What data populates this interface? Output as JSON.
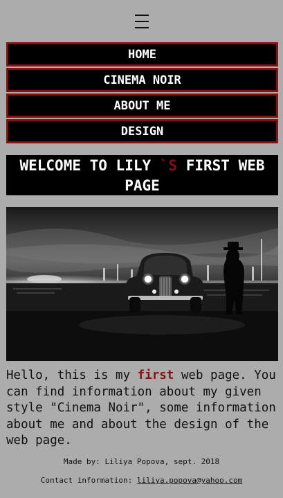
{
  "menu_icon": "hamburger-menu-icon",
  "nav": {
    "items": [
      {
        "label": "HOME"
      },
      {
        "label": "CINEMA NOIR"
      },
      {
        "label": "ABOUT ME"
      },
      {
        "label": "DESIGN"
      }
    ]
  },
  "hero": {
    "title_before": "WELCOME TO LILY ",
    "title_accent": "`S",
    "title_after": " FIRST WEB PAGE"
  },
  "photo": {
    "icon": "noir-car-city-night-photo"
  },
  "intro": {
    "before": "Hello, this is my ",
    "highlight": "first",
    "after": " web page. You can find information about my given style \"Cinema Noir\", some information about me and about the design of the web page."
  },
  "footer": {
    "made_by": "Made by: Liliya Popova, sept. 2018",
    "contact_label": "Contact information: ",
    "email": "liliya.popova@yahoo.com"
  },
  "colors": {
    "background": "#acacac",
    "accent": "#8a0f0f",
    "nav_bg": "#000000"
  }
}
